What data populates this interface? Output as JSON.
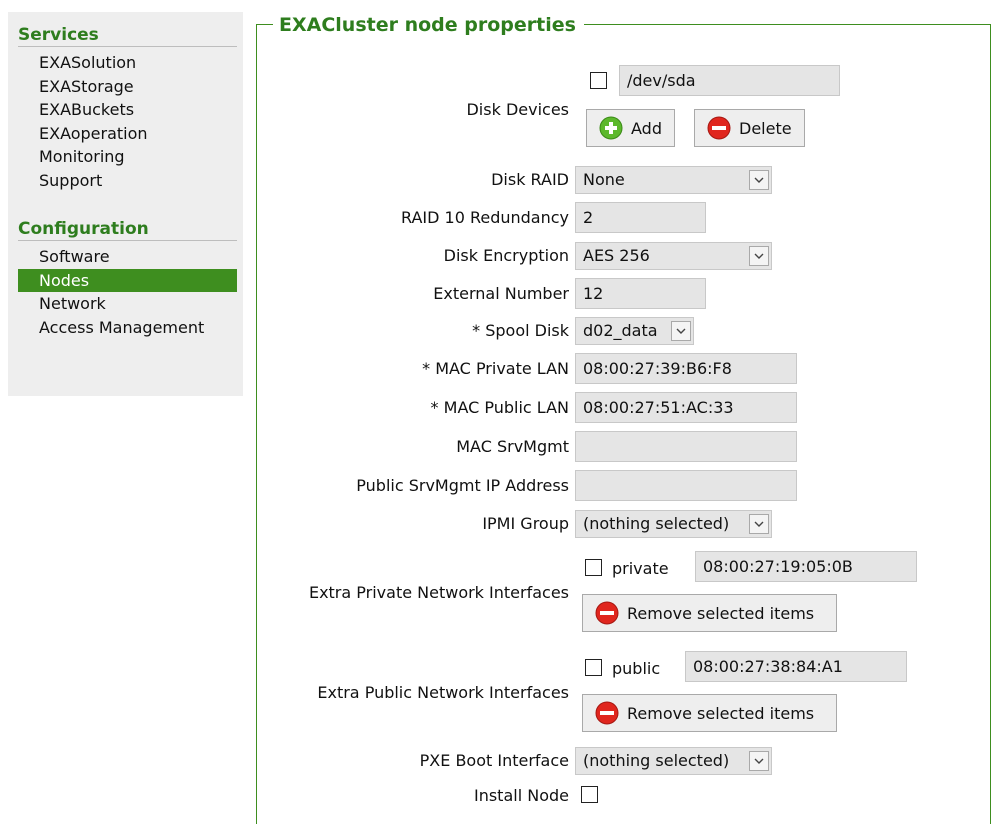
{
  "sidebar": {
    "services_heading": "Services",
    "services_items": [
      "EXASolution",
      "EXAStorage",
      "EXABuckets",
      "EXAoperation",
      "Monitoring",
      "Support"
    ],
    "configuration_heading": "Configuration",
    "configuration_items": [
      "Software",
      "Nodes",
      "Network",
      "Access Management"
    ],
    "active_item": "Nodes",
    "accent_color": "#3e8e1f"
  },
  "panel": {
    "title": "EXACluster node properties"
  },
  "form": {
    "disk_devices": {
      "label": "Disk Devices",
      "device_value": "/dev/sda",
      "add_label": "Add",
      "delete_label": "Delete"
    },
    "disk_raid": {
      "label": "Disk RAID",
      "value": "None"
    },
    "raid10_redundancy": {
      "label": "RAID 10 Redundancy",
      "value": "2"
    },
    "disk_encryption": {
      "label": "Disk Encryption",
      "value": "AES 256"
    },
    "external_number": {
      "label": "External Number",
      "value": "12"
    },
    "spool_disk": {
      "label": "* Spool Disk",
      "value": "d02_data"
    },
    "mac_private_lan": {
      "label": "* MAC Private LAN",
      "value": "08:00:27:39:B6:F8"
    },
    "mac_public_lan": {
      "label": "* MAC Public LAN",
      "value": "08:00:27:51:AC:33"
    },
    "mac_srvmgmt": {
      "label": "MAC SrvMgmt",
      "value": ""
    },
    "public_srvmgmt_ip": {
      "label": "Public SrvMgmt IP Address",
      "value": ""
    },
    "ipmi_group": {
      "label": "IPMI Group",
      "value": "(nothing selected)"
    },
    "extra_private": {
      "label": "Extra Private Network Interfaces",
      "checkbox_label": "private",
      "value": "08:00:27:19:05:0B",
      "remove_label": "Remove selected items"
    },
    "extra_public": {
      "label": "Extra Public Network Interfaces",
      "checkbox_label": "public",
      "value": "08:00:27:38:84:A1",
      "remove_label": "Remove selected items"
    },
    "pxe_boot_interface": {
      "label": "PXE Boot Interface",
      "value": "(nothing selected)"
    },
    "install_node": {
      "label": "Install Node"
    }
  }
}
